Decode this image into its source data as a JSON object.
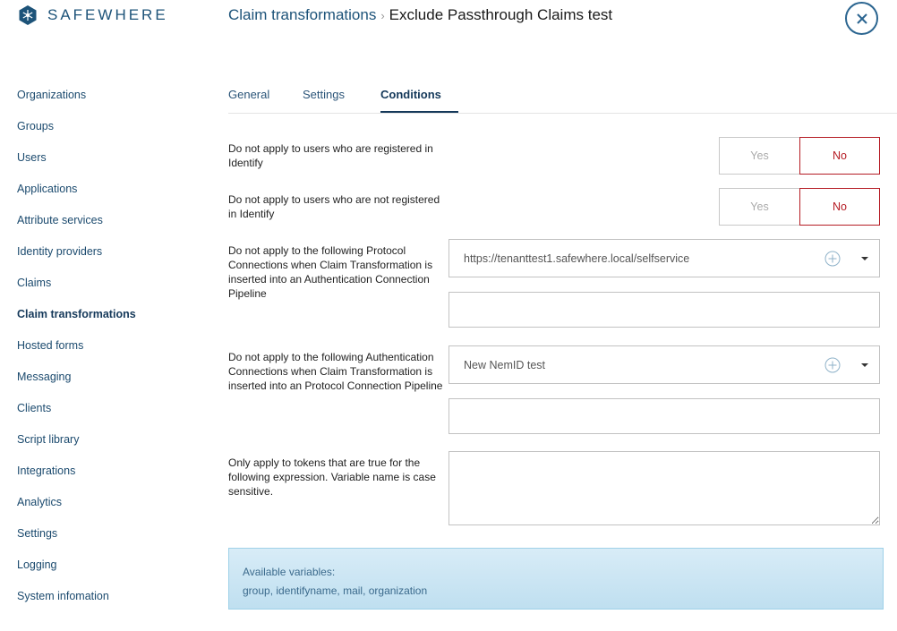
{
  "brand": {
    "name": "SAFEWHERE"
  },
  "sidebar": {
    "items": [
      {
        "label": "Organizations"
      },
      {
        "label": "Groups"
      },
      {
        "label": "Users"
      },
      {
        "label": "Applications"
      },
      {
        "label": "Attribute services"
      },
      {
        "label": "Identity providers"
      },
      {
        "label": "Claims"
      },
      {
        "label": "Claim transformations",
        "active": true
      },
      {
        "label": "Hosted forms"
      },
      {
        "label": "Messaging"
      },
      {
        "label": "Clients"
      },
      {
        "label": "Script library"
      },
      {
        "label": "Integrations"
      },
      {
        "label": "Analytics"
      },
      {
        "label": "Settings"
      },
      {
        "label": "Logging"
      },
      {
        "label": "System infomation"
      }
    ]
  },
  "header": {
    "breadcrumb_parent": "Claim transformations",
    "breadcrumb_separator": "›",
    "title": "Exclude Passthrough Claims test",
    "close_icon": "close-icon"
  },
  "tabs": [
    {
      "label": "General"
    },
    {
      "label": "Settings"
    },
    {
      "label": "Conditions",
      "active": true
    }
  ],
  "conditions": {
    "registered": {
      "label": "Do not apply to users who are registered in Identify",
      "yes_label": "Yes",
      "no_label": "No",
      "selected": "No"
    },
    "not_registered": {
      "label": "Do not apply to users who are not registered in Identify",
      "yes_label": "Yes",
      "no_label": "No",
      "selected": "No"
    },
    "protocol_connections": {
      "label": "Do not apply to the following Protocol Connections when Claim Transformation is inserted into an Authentication Connection Pipeline",
      "selected_value": "https://tenanttest1.safewhere.local/selfservice",
      "list_value": ""
    },
    "authentication_connections": {
      "label": "Do not apply to the following Authentication Connections when Claim Transformation is inserted into an Protocol Connection Pipeline",
      "selected_value": "New NemID test",
      "list_value": ""
    },
    "expression": {
      "label": "Only apply to tokens that are true for the following expression. Variable name is case sensitive.",
      "value": ""
    }
  },
  "info": {
    "title": "Available variables:",
    "variables": "group, identifyname, mail, organization"
  },
  "colors": {
    "brand": "#1d5379",
    "selected_no": "#b51c24",
    "info_bg": "#cfe7f4"
  }
}
